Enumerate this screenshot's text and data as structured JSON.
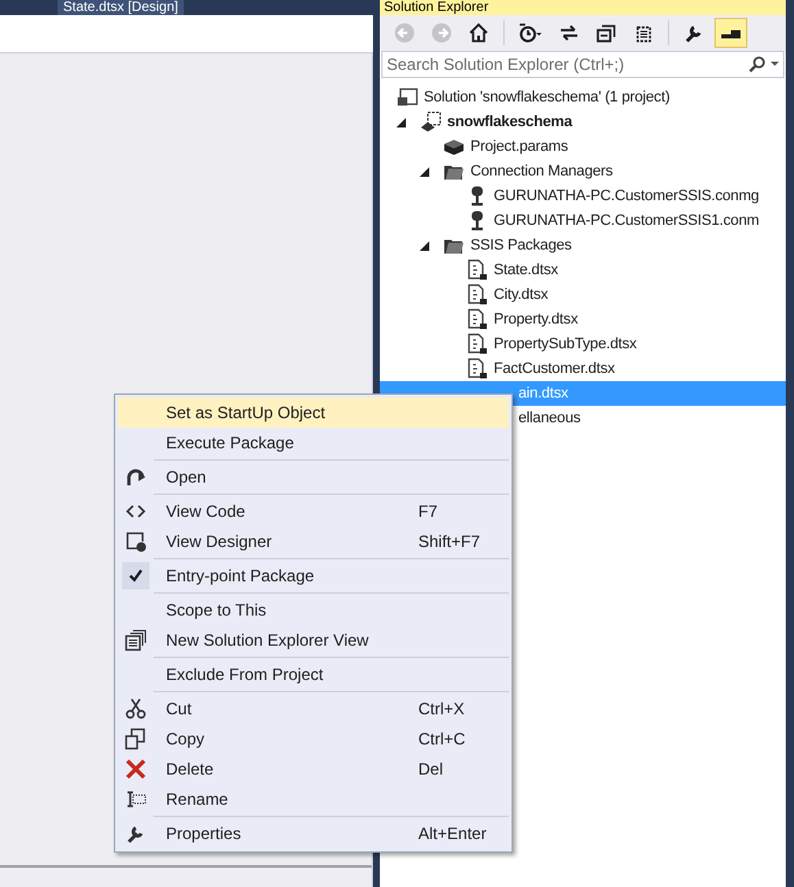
{
  "document_tab": {
    "title": "State.dtsx [Design]"
  },
  "solution_explorer": {
    "title": "Solution Explorer",
    "toolbar": [
      {
        "kind": "back",
        "disabled": true
      },
      {
        "kind": "forward",
        "disabled": true
      },
      {
        "kind": "home",
        "disabled": false
      },
      {
        "kind": "separator"
      },
      {
        "kind": "history",
        "disabled": false
      },
      {
        "kind": "sync",
        "disabled": false
      },
      {
        "kind": "collapse",
        "disabled": false
      },
      {
        "kind": "showall",
        "disabled": false
      },
      {
        "kind": "separator"
      },
      {
        "kind": "properties",
        "disabled": false
      },
      {
        "kind": "preview",
        "disabled": false,
        "on": true
      }
    ],
    "search": {
      "placeholder": "Search Solution Explorer (Ctrl+;)"
    },
    "tree": [
      {
        "label": "Solution 'snowflakeschema' (1 project)",
        "kind": "solution",
        "selected": false,
        "children": [
          {
            "label": "snowflakeschema",
            "kind": "project",
            "bold": true,
            "expanded": true,
            "selected": false,
            "children": [
              {
                "label": "Project.params",
                "kind": "params",
                "selected": false
              },
              {
                "label": "Connection Managers",
                "kind": "folder",
                "expanded": true,
                "selected": false,
                "children": [
                  {
                    "label": "GURUNATHA-PC.CustomerSSIS.conmg",
                    "kind": "connection",
                    "selected": false
                  },
                  {
                    "label": "GURUNATHA-PC.CustomerSSIS1.conm",
                    "kind": "connection",
                    "selected": false
                  }
                ]
              },
              {
                "label": "SSIS Packages",
                "kind": "folder",
                "expanded": true,
                "selected": false,
                "children": [
                  {
                    "label": "State.dtsx",
                    "kind": "package",
                    "selected": false
                  },
                  {
                    "label": "City.dtsx",
                    "kind": "package",
                    "selected": false
                  },
                  {
                    "label": "Property.dtsx",
                    "kind": "package",
                    "selected": false
                  },
                  {
                    "label": "PropertySubType.dtsx",
                    "kind": "package",
                    "selected": false
                  },
                  {
                    "label": "FactCustomer.dtsx",
                    "kind": "package",
                    "selected": false
                  },
                  {
                    "label": "ain.dtsx",
                    "kind": "hidden",
                    "selected": true
                  }
                ]
              },
              {
                "label": "ellaneous",
                "kind": "hidden",
                "selected": false
              }
            ]
          }
        ]
      }
    ]
  },
  "context_menu": [
    {
      "kind": "item",
      "label": "Set as StartUp Object",
      "selected": true,
      "checked": false
    },
    {
      "kind": "item",
      "label": "Execute Package",
      "selected": false,
      "checked": false
    },
    {
      "kind": "separator"
    },
    {
      "kind": "open",
      "label": "Open",
      "selected": false,
      "checked": false
    },
    {
      "kind": "separator"
    },
    {
      "kind": "code",
      "label": "View Code",
      "shortcut": "F7",
      "selected": false,
      "checked": false
    },
    {
      "kind": "designer",
      "label": "View Designer",
      "shortcut": "Shift+F7",
      "selected": false,
      "checked": false
    },
    {
      "kind": "separator"
    },
    {
      "kind": "item",
      "label": "Entry-point Package",
      "selected": false,
      "checked": true
    },
    {
      "kind": "separator"
    },
    {
      "kind": "item",
      "label": "Scope to This",
      "selected": false,
      "checked": false
    },
    {
      "kind": "newview",
      "label": "New Solution Explorer View",
      "selected": false,
      "checked": false
    },
    {
      "kind": "separator"
    },
    {
      "kind": "item",
      "label": "Exclude From Project",
      "selected": false,
      "checked": false
    },
    {
      "kind": "separator"
    },
    {
      "kind": "cut",
      "label": "Cut",
      "shortcut": "Ctrl+X",
      "selected": false,
      "checked": false
    },
    {
      "kind": "copy",
      "label": "Copy",
      "shortcut": "Ctrl+C",
      "selected": false,
      "checked": false
    },
    {
      "kind": "delete",
      "label": "Delete",
      "shortcut": "Del",
      "selected": false,
      "checked": false
    },
    {
      "kind": "rename",
      "label": "Rename",
      "selected": false,
      "checked": false
    },
    {
      "kind": "separator"
    },
    {
      "kind": "properties",
      "label": "Properties",
      "shortcut": "Alt+Enter",
      "selected": false,
      "checked": false
    }
  ]
}
